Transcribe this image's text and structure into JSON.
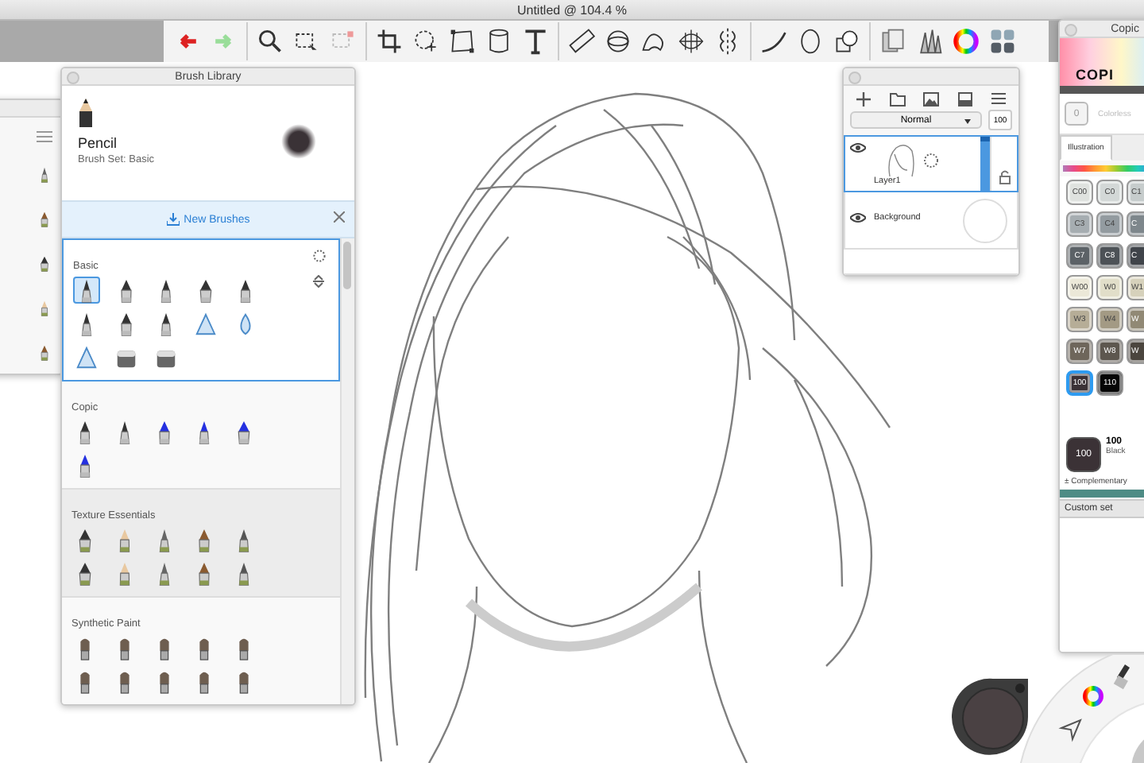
{
  "window": {
    "title": "Untitled @ 104.4 %"
  },
  "brush_library": {
    "title": "Brush Library",
    "current_brush": {
      "name": "Pencil",
      "set": "Brush Set: Basic"
    },
    "banner": {
      "label": "New Brushes"
    },
    "sets": [
      {
        "name": "Basic",
        "selected": true,
        "brushes": [
          {
            "selected": true
          },
          {
            "selected": false
          },
          {
            "selected": false
          },
          {
            "selected": false
          },
          {
            "selected": false
          },
          {
            "selected": false
          },
          {
            "selected": false
          },
          {
            "selected": false
          },
          {
            "selected": false
          },
          {
            "selected": false
          },
          {
            "selected": false
          },
          {
            "selected": false
          },
          {
            "selected": false
          }
        ]
      },
      {
        "name": "Copic",
        "selected": false,
        "brushes": [
          {
            "selected": false
          },
          {
            "selected": false
          },
          {
            "selected": false
          },
          {
            "selected": false
          },
          {
            "selected": false
          },
          {
            "selected": false
          }
        ]
      },
      {
        "name": "Texture Essentials",
        "selected": false,
        "brushes": [
          {
            "selected": false
          },
          {
            "selected": false
          },
          {
            "selected": false
          },
          {
            "selected": false
          },
          {
            "selected": false
          },
          {
            "selected": false
          },
          {
            "selected": false
          },
          {
            "selected": false
          },
          {
            "selected": false
          },
          {
            "selected": false
          }
        ]
      },
      {
        "name": "Synthetic Paint",
        "selected": false,
        "brushes": [
          {
            "selected": false
          },
          {
            "selected": false
          },
          {
            "selected": false
          },
          {
            "selected": false
          },
          {
            "selected": false
          },
          {
            "selected": false
          },
          {
            "selected": false
          },
          {
            "selected": false
          },
          {
            "selected": false
          },
          {
            "selected": false
          }
        ]
      }
    ]
  },
  "layers": {
    "blend_mode": "Normal",
    "opacity": "100",
    "items": [
      {
        "name": "Layer1",
        "selected": true,
        "visible": true
      },
      {
        "name": "Background",
        "selected": false,
        "visible": true
      }
    ]
  },
  "copic": {
    "title": "Copic",
    "logo": "COPI",
    "colorless": {
      "code": "0",
      "label": "Colorless"
    },
    "tabs": [
      {
        "label": "Illustration",
        "selected": true
      }
    ],
    "colors": [
      {
        "code": "C00",
        "color": "#dfe2df",
        "selected": false
      },
      {
        "code": "C0",
        "color": "#d3d8d7",
        "selected": false
      },
      {
        "code": "C1",
        "color": "#c6cccc",
        "selected": false
      },
      {
        "code": "C3",
        "color": "#a6adb1",
        "selected": false
      },
      {
        "code": "C4",
        "color": "#939ba0",
        "selected": false
      },
      {
        "code": "C",
        "color": "#7e878c",
        "selected": false
      },
      {
        "code": "C7",
        "color": "#5c6267",
        "selected": false
      },
      {
        "code": "C8",
        "color": "#4d5257",
        "selected": false
      },
      {
        "code": "C",
        "color": "#40444a",
        "selected": false
      },
      {
        "code": "W00",
        "color": "#ebe8d8",
        "selected": false
      },
      {
        "code": "W0",
        "color": "#e1dec9",
        "selected": false
      },
      {
        "code": "W1",
        "color": "#d6d1bb",
        "selected": false
      },
      {
        "code": "W3",
        "color": "#b6ad97",
        "selected": false
      },
      {
        "code": "W4",
        "color": "#a39a84",
        "selected": false
      },
      {
        "code": "W",
        "color": "#918975",
        "selected": false
      },
      {
        "code": "W7",
        "color": "#6e665b",
        "selected": false
      },
      {
        "code": "W8",
        "color": "#5d574f",
        "selected": false
      },
      {
        "code": "W",
        "color": "#4b453e",
        "selected": false
      },
      {
        "code": "100",
        "color": "#3b3236",
        "selected": true
      },
      {
        "code": "110",
        "color": "#060606",
        "selected": false
      }
    ],
    "current": {
      "chip": "100",
      "code": "100",
      "name": "Black",
      "color": "#3b3236"
    },
    "complementary": "± Complementary",
    "custom_set": "Custom set"
  }
}
